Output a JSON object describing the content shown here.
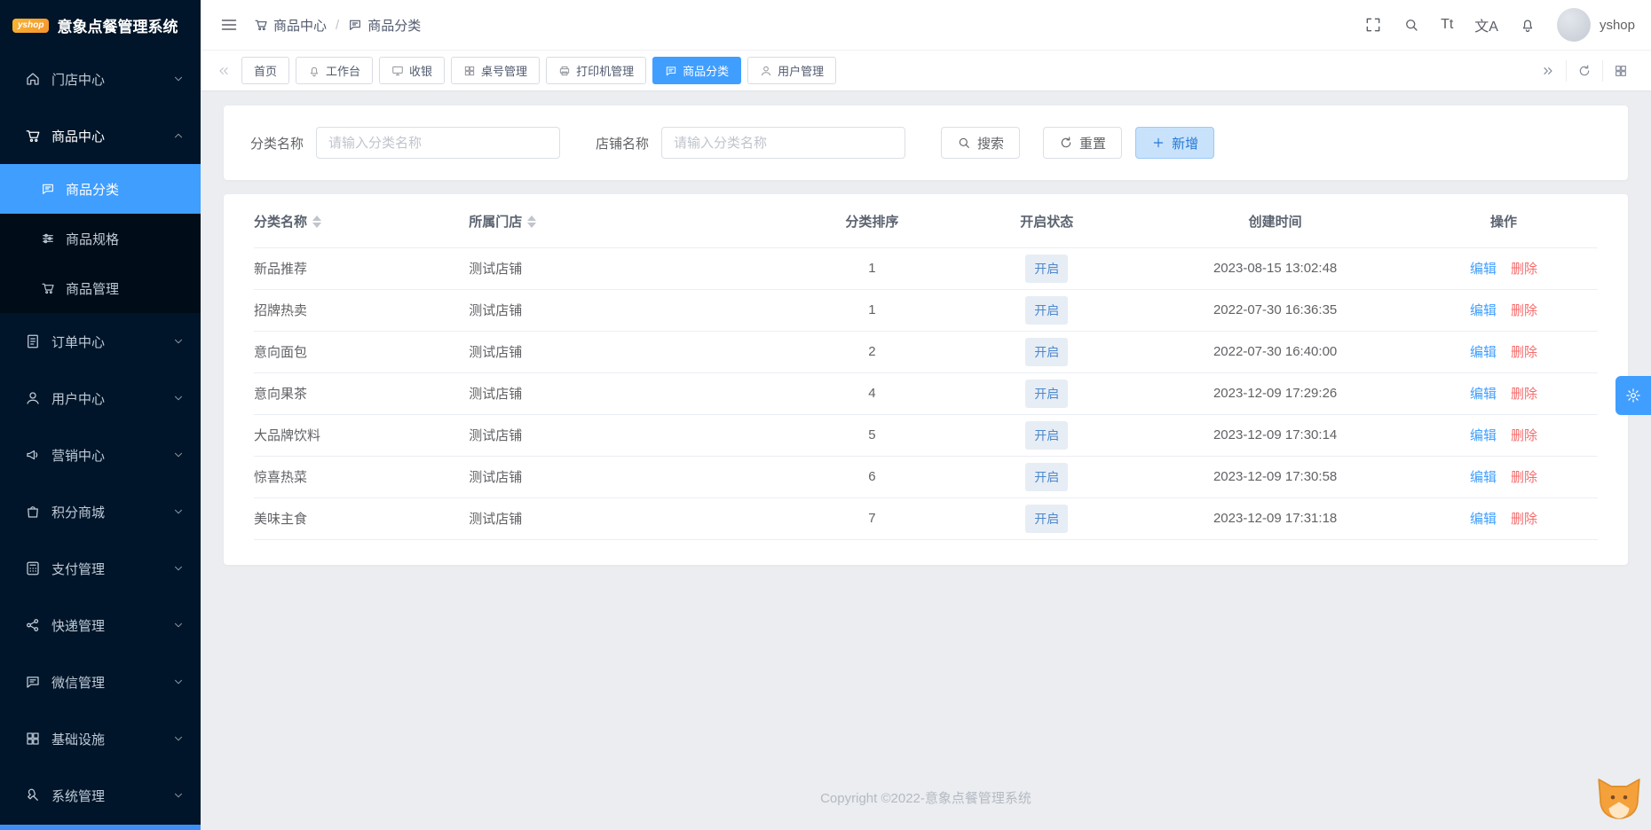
{
  "app": {
    "logo_badge": "yshop",
    "title": "意象点餐管理系统"
  },
  "sidebar": {
    "items": [
      {
        "label": "门店中心",
        "icon": "home-icon"
      },
      {
        "label": "商品中心",
        "icon": "cart-icon",
        "expanded": true,
        "children": [
          {
            "label": "商品分类",
            "icon": "chat-icon",
            "active": true
          },
          {
            "label": "商品规格",
            "icon": "sliders-icon"
          },
          {
            "label": "商品管理",
            "icon": "cart-icon"
          }
        ]
      },
      {
        "label": "订单中心",
        "icon": "document-icon"
      },
      {
        "label": "用户中心",
        "icon": "user-icon"
      },
      {
        "label": "营销中心",
        "icon": "megaphone-icon"
      },
      {
        "label": "积分商城",
        "icon": "bag-icon"
      },
      {
        "label": "支付管理",
        "icon": "calculator-icon"
      },
      {
        "label": "快递管理",
        "icon": "share-icon"
      },
      {
        "label": "微信管理",
        "icon": "wechat-icon"
      },
      {
        "label": "基础设施",
        "icon": "grid-icon"
      },
      {
        "label": "系统管理",
        "icon": "wrench-icon"
      }
    ]
  },
  "header": {
    "breadcrumb": [
      {
        "label": "商品中心",
        "icon": "cart-icon"
      },
      {
        "label": "商品分类",
        "icon": "chat-icon"
      }
    ],
    "separator": "/",
    "font_tool": "Tt",
    "translate_tool": "文A",
    "username": "yshop"
  },
  "tabbar": {
    "tabs": [
      {
        "label": "首页"
      },
      {
        "label": "工作台",
        "icon": "bell-icon"
      },
      {
        "label": "收银",
        "icon": "monitor-icon"
      },
      {
        "label": "桌号管理",
        "icon": "grid-icon"
      },
      {
        "label": "打印机管理",
        "icon": "printer-icon"
      },
      {
        "label": "商品分类",
        "icon": "chat-icon",
        "active": true
      },
      {
        "label": "用户管理",
        "icon": "user-icon"
      }
    ]
  },
  "filters": {
    "category_label": "分类名称",
    "category_placeholder": "请输入分类名称",
    "category_value": "",
    "store_label": "店铺名称",
    "store_placeholder": "请输入分类名称",
    "store_value": "",
    "search_label": "搜索",
    "reset_label": "重置",
    "add_label": "新增"
  },
  "table": {
    "columns": [
      "分类名称",
      "所属门店",
      "分类排序",
      "开启状态",
      "创建时间",
      "操作"
    ],
    "edit_label": "编辑",
    "delete_label": "删除",
    "rows": [
      {
        "name": "新品推荐",
        "store": "测试店铺",
        "sort": "1",
        "status": "开启",
        "created": "2023-08-15 13:02:48"
      },
      {
        "name": "招牌热卖",
        "store": "测试店铺",
        "sort": "1",
        "status": "开启",
        "created": "2022-07-30 16:36:35"
      },
      {
        "name": "意向面包",
        "store": "测试店铺",
        "sort": "2",
        "status": "开启",
        "created": "2022-07-30 16:40:00"
      },
      {
        "name": "意向果茶",
        "store": "测试店铺",
        "sort": "4",
        "status": "开启",
        "created": "2023-12-09 17:29:26"
      },
      {
        "name": "大品牌饮料",
        "store": "测试店铺",
        "sort": "5",
        "status": "开启",
        "created": "2023-12-09 17:30:14"
      },
      {
        "name": "惊喜热菜",
        "store": "测试店铺",
        "sort": "6",
        "status": "开启",
        "created": "2023-12-09 17:30:58"
      },
      {
        "name": "美味主食",
        "store": "测试店铺",
        "sort": "7",
        "status": "开启",
        "created": "2023-12-09 17:31:18"
      }
    ]
  },
  "footer": {
    "copyright": "Copyright ©2022-意象点餐管理系统"
  },
  "colors": {
    "primary": "#409eff",
    "danger": "#f56c6c",
    "sidebar_bg": "#001529",
    "active_tab": "#409eff"
  }
}
